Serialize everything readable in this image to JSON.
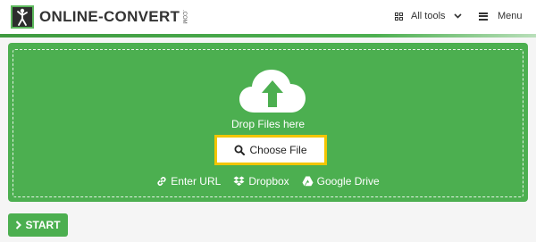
{
  "header": {
    "logo_text": "ONLINE-CONVERT",
    "logo_suffix": ".COM",
    "all_tools_label": "All tools",
    "menu_label": "Menu"
  },
  "upload": {
    "drop_text": "Drop Files here",
    "choose_file_label": "Choose File",
    "sources": [
      {
        "label": "Enter URL",
        "icon": "link-icon"
      },
      {
        "label": "Dropbox",
        "icon": "dropbox-icon"
      },
      {
        "label": "Google Drive",
        "icon": "google-drive-icon"
      }
    ]
  },
  "start_label": "START",
  "colors": {
    "accent_green": "#4caf50",
    "highlight_yellow": "#f2c500"
  }
}
